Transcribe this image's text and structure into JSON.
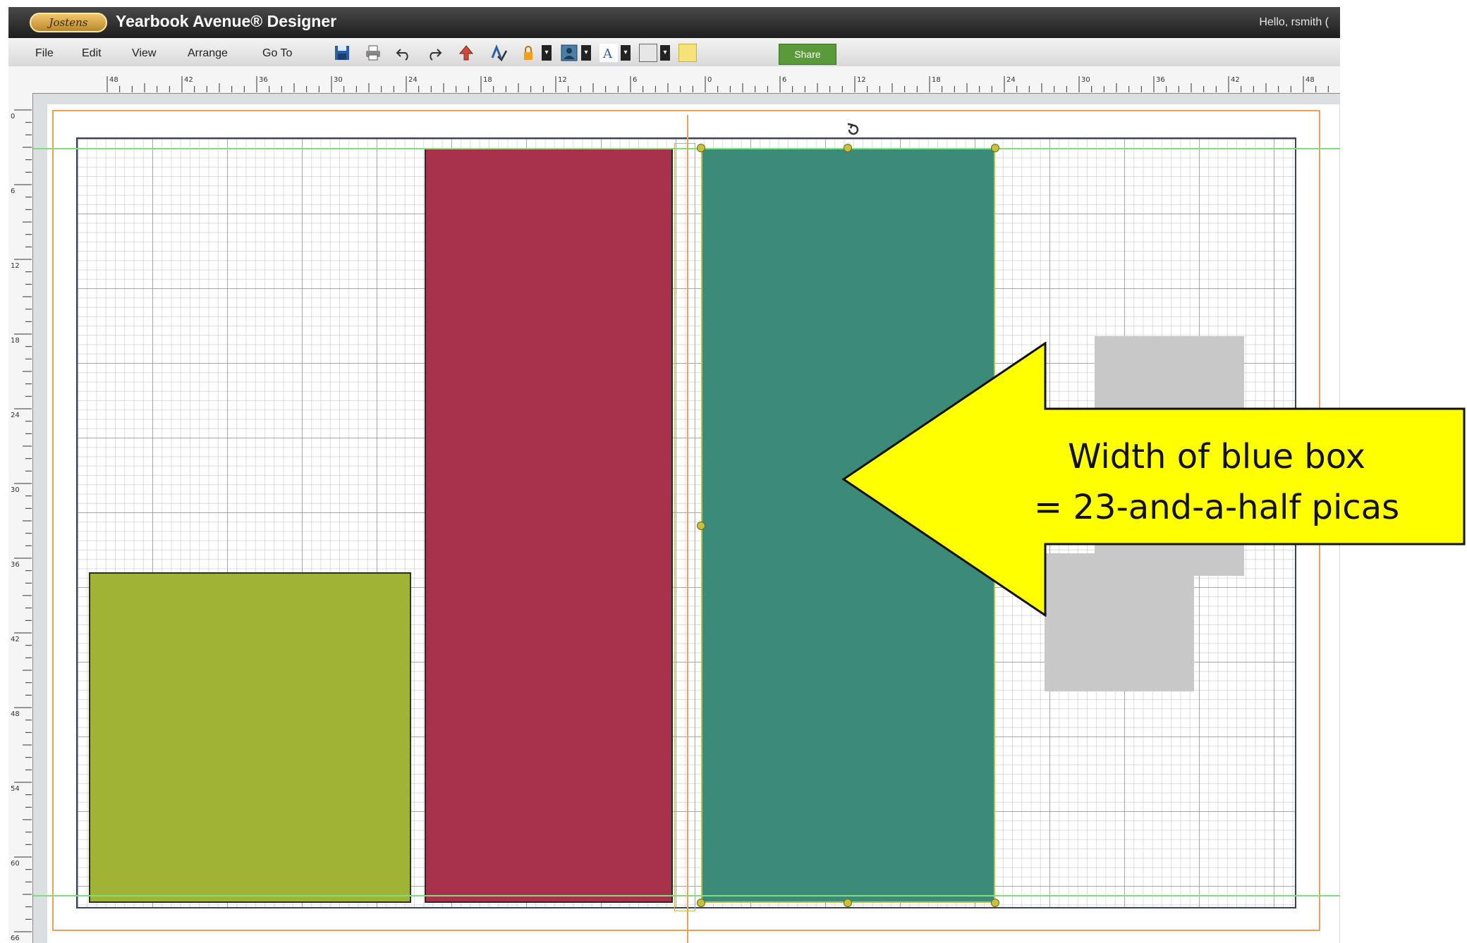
{
  "app": {
    "logo_text": "Jostens",
    "title": "Yearbook Avenue® Designer",
    "greeting": "Hello, rsmith ("
  },
  "menu": {
    "items": [
      "File",
      "Edit",
      "View",
      "Arrange",
      "Go To"
    ]
  },
  "toolbar": {
    "icons": [
      "save-icon",
      "print-icon",
      "undo-icon",
      "redo-icon",
      "upload-icon",
      "spellcheck-icon",
      "lock-icon",
      "image-icon",
      "text-color-icon",
      "fill-color-icon",
      "sticky-note-icon"
    ],
    "share_label": "Share",
    "fill_swatch_color": "#e6e6e6",
    "note_color": "#f5e27a"
  },
  "rulers": {
    "horizontal_labels": [
      "48",
      "42",
      "36",
      "30",
      "24",
      "18",
      "12",
      "6",
      "0",
      "6",
      "12",
      "18",
      "24",
      "30",
      "36",
      "42",
      "48"
    ],
    "vertical_labels": [
      "0",
      "6",
      "12",
      "18",
      "24",
      "30",
      "36",
      "42",
      "48",
      "54",
      "60",
      "66"
    ]
  },
  "canvas": {
    "shapes": [
      {
        "name": "green-box",
        "color": "#a0b334"
      },
      {
        "name": "red-box",
        "color": "#a8324b"
      },
      {
        "name": "teal-box",
        "color": "#3c8a78",
        "selected": true
      }
    ],
    "guide_color": "#7ee07a",
    "margin_color": "#f1a050"
  },
  "callout": {
    "line1": "Width of blue box",
    "line2": "= 23-and-a-half picas",
    "color": "#ffff00"
  }
}
